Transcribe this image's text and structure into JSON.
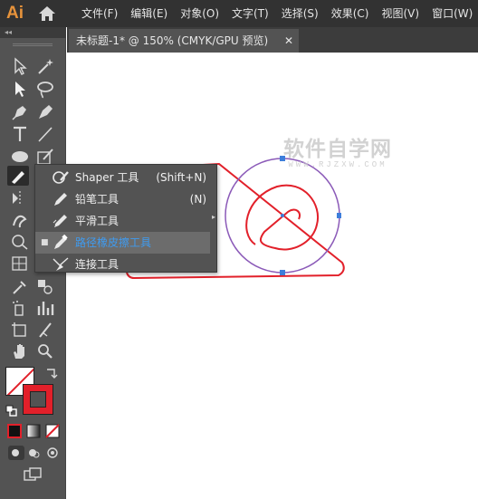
{
  "app": {
    "logo_text": "Ai"
  },
  "menubar": {
    "items": [
      "文件(F)",
      "编辑(E)",
      "对象(O)",
      "文字(T)",
      "选择(S)",
      "效果(C)",
      "视图(V)",
      "窗口(W)"
    ]
  },
  "toolbar": {
    "collapse_glyph": "◂◂"
  },
  "document_tab": {
    "title": "未标题-1* @ 150% (CMYK/GPU 预览)",
    "close_glyph": "✕"
  },
  "flyout": {
    "items": [
      {
        "label": "Shaper 工具",
        "shortcut": "(Shift+N)",
        "icon": "shaper-icon",
        "selected": false
      },
      {
        "label": "铅笔工具",
        "shortcut": "(N)",
        "icon": "pencil-icon",
        "selected": false
      },
      {
        "label": "平滑工具",
        "shortcut": "",
        "icon": "smooth-icon",
        "selected": false
      },
      {
        "label": "路径橡皮擦工具",
        "shortcut": "",
        "icon": "path-eraser-icon",
        "selected": true
      },
      {
        "label": "连接工具",
        "shortcut": "",
        "icon": "join-icon",
        "selected": false
      }
    ],
    "bullet": "■",
    "tearoff_glyph": "▸"
  },
  "watermark": {
    "main": "软件自学网",
    "sub": "WWW.RJZXW.COM"
  },
  "colors": {
    "accent_red": "#e2202a",
    "selection_purple": "#8b5ab8",
    "anchor_blue": "#3d7edb",
    "selected_text": "#3f9bf0"
  }
}
